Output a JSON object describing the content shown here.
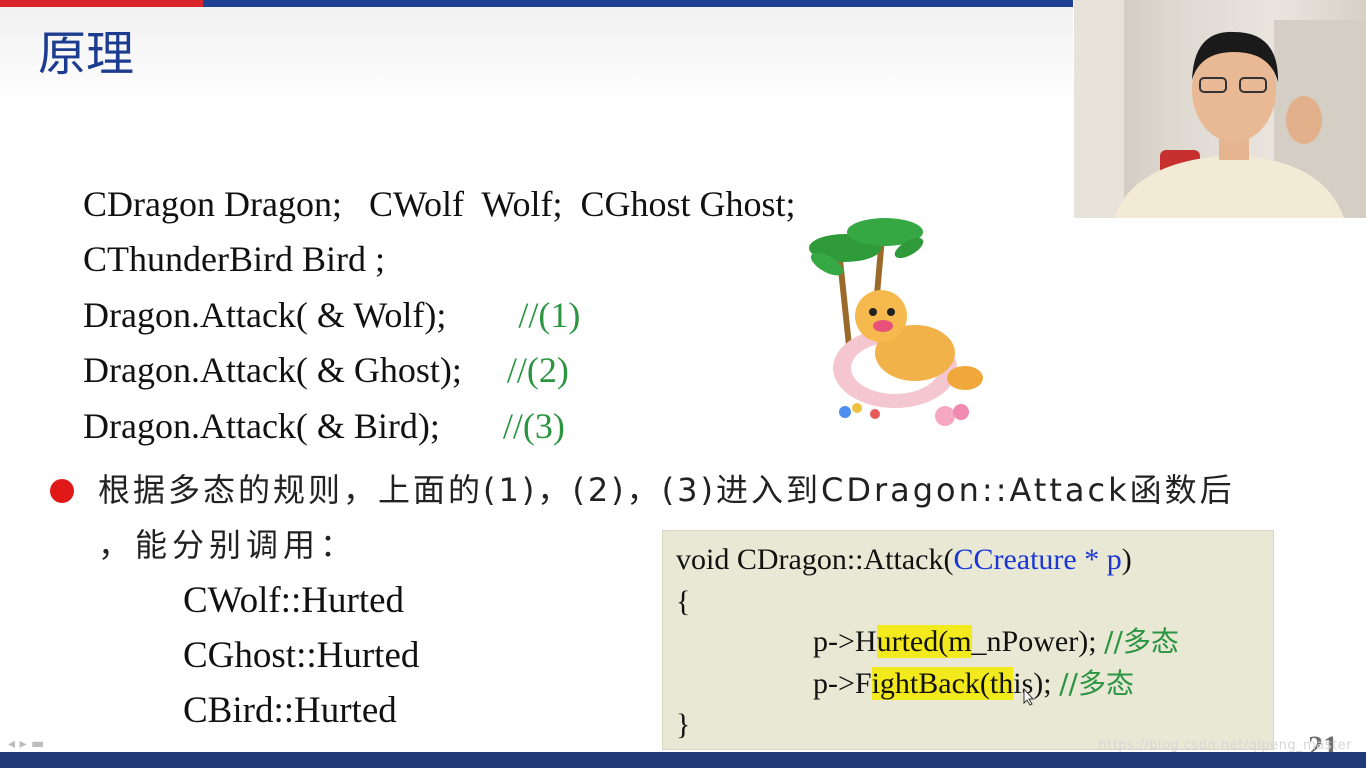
{
  "slide": {
    "title": "原理",
    "page_number": "21"
  },
  "code_lines": [
    {
      "code": "CDragon Dragon;   CWolf  Wolf;  CGhost Ghost;",
      "comment": ""
    },
    {
      "code": "CThunderBird Bird ;",
      "comment": ""
    },
    {
      "code": "Dragon.Attack( & Wolf);        ",
      "comment": "//(1)"
    },
    {
      "code": "Dragon.Attack( & Ghost);     ",
      "comment": "//(2)"
    },
    {
      "code": "Dragon.Attack( & Bird);       ",
      "comment": "//(3)"
    }
  ],
  "bullet": {
    "line1": "根据多态的规则，上面的(1)，(2)，(3)进入到CDragon::Attack函数后",
    "line2": "，能分别调用：",
    "items": [
      "CWolf::Hurted",
      "CGhost::Hurted",
      "CBird::Hurted"
    ]
  },
  "code_box": {
    "signature_prefix": "void CDragon::Attack(",
    "signature_param": "CCreature * p",
    "signature_suffix": ")",
    "open_brace": "{",
    "line1_a": "p->H",
    "line1_hl": "urted(m",
    "line1_b": "_nPower);",
    "line1_comment": "//多态",
    "line2_a": "p->F",
    "line2_hl": "ightBack(th",
    "line2_b": "is);",
    "line2_comment": "//多态",
    "close_brace": "}"
  },
  "footer": {
    "watermark": "https://blog.csdn.net/qipeng_master"
  },
  "colors": {
    "title": "#1c3c8f",
    "comment_green": "#2a9440",
    "param_blue": "#1a36d6",
    "highlight": "#f2ea1c",
    "bullet_red": "#e01818",
    "code_box_bg": "#e9e8d5"
  }
}
